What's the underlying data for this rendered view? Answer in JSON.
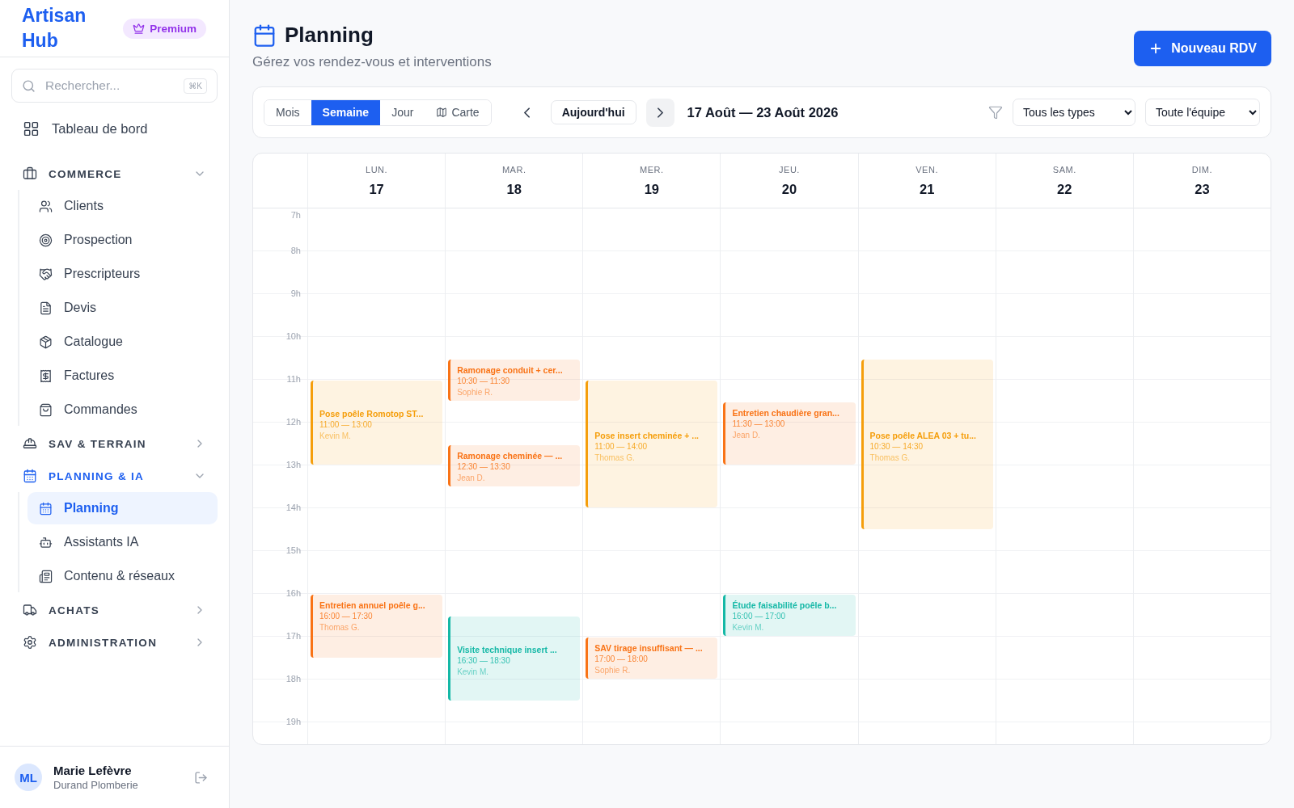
{
  "sidebar": {
    "logo": "Artisan Hub",
    "badge": "Premium",
    "search": {
      "placeholder": "Rechercher...",
      "shortcut": "⌘K"
    },
    "nav": [
      {
        "kind": "link",
        "label": "Tableau de bord",
        "selected": false
      },
      {
        "kind": "group",
        "label": "COMMERCE",
        "expanded": true,
        "active": false,
        "children": [
          {
            "label": "Clients",
            "selected": false
          },
          {
            "label": "Prospection",
            "selected": false
          },
          {
            "label": "Prescripteurs",
            "selected": false
          },
          {
            "label": "Devis",
            "selected": false
          },
          {
            "label": "Catalogue",
            "selected": false
          },
          {
            "label": "Factures",
            "selected": false
          },
          {
            "label": "Commandes",
            "selected": false
          }
        ]
      },
      {
        "kind": "group",
        "label": "SAV & TERRAIN",
        "expanded": false,
        "active": false
      },
      {
        "kind": "group",
        "label": "PLANNING & IA",
        "expanded": true,
        "active": true,
        "children": [
          {
            "label": "Planning",
            "selected": true
          },
          {
            "label": "Assistants IA",
            "selected": false
          },
          {
            "label": "Contenu & réseaux",
            "selected": false
          }
        ]
      },
      {
        "kind": "group",
        "label": "ACHATS",
        "expanded": false,
        "active": false
      },
      {
        "kind": "group",
        "label": "ADMINISTRATION",
        "expanded": false,
        "active": false
      }
    ],
    "user": {
      "initials": "ML",
      "name": "Marie Lefèvre",
      "company": "Durand Plomberie"
    }
  },
  "header": {
    "title": "Planning",
    "subtitle": "Gérez vos rendez-vous et interventions",
    "new_button": "Nouveau RDV"
  },
  "toolbar": {
    "views": [
      {
        "label": "Mois",
        "selected": false
      },
      {
        "label": "Semaine",
        "selected": true
      },
      {
        "label": "Jour",
        "selected": false
      },
      {
        "label": "Carte",
        "selected": false
      }
    ],
    "today": "Aujourd'hui",
    "range": "17 Août — 23 Août 2026",
    "filters": [
      "Tous les types",
      "Toute l'équipe"
    ]
  },
  "calendar": {
    "hours": [
      "7h",
      "8h",
      "9h",
      "10h",
      "11h",
      "12h",
      "13h",
      "14h",
      "15h",
      "16h",
      "17h",
      "18h",
      "19h"
    ],
    "days": [
      {
        "dow": "LUN.",
        "date": "17",
        "events": [
          {
            "title": "Pose poêle Romotop ST...",
            "time": "11:00 — 13:00",
            "person": "Kevin M.",
            "color": "#f59e0b"
          },
          {
            "title": "Entretien annuel poêle g...",
            "time": "16:00 — 17:30",
            "person": "Thomas G.",
            "color": "#f97316"
          }
        ]
      },
      {
        "dow": "MAR.",
        "date": "18",
        "events": [
          {
            "title": "Ramonage conduit + cer...",
            "time": "10:30 — 11:30",
            "person": "Sophie R.",
            "color": "#f97316"
          },
          {
            "title": "Ramonage cheminée — ...",
            "time": "12:30 — 13:30",
            "person": "Jean D.",
            "color": "#f97316"
          },
          {
            "title": "Visite technique insert ...",
            "time": "16:30 — 18:30",
            "person": "Kevin M.",
            "color": "#14b8a6"
          }
        ]
      },
      {
        "dow": "MER.",
        "date": "19",
        "events": [
          {
            "title": "Pose insert cheminée + ...",
            "time": "11:00 — 14:00",
            "person": "Thomas G.",
            "color": "#f59e0b"
          },
          {
            "title": "SAV tirage insuffisant — ...",
            "time": "17:00 — 18:00",
            "person": "Sophie R.",
            "color": "#f97316"
          }
        ]
      },
      {
        "dow": "JEU.",
        "date": "20",
        "events": [
          {
            "title": "Entretien chaudière gran...",
            "time": "11:30 — 13:00",
            "person": "Jean D.",
            "color": "#f97316"
          },
          {
            "title": "Étude faisabilité poêle b...",
            "time": "16:00 — 17:00",
            "person": "Kevin M.",
            "color": "#14b8a6"
          }
        ]
      },
      {
        "dow": "VEN.",
        "date": "21",
        "events": [
          {
            "title": "Pose poêle ALEA 03 + tu...",
            "time": "10:30 — 14:30",
            "person": "Thomas G.",
            "color": "#f59e0b"
          }
        ]
      },
      {
        "dow": "SAM.",
        "date": "22"
      },
      {
        "dow": "DIM.",
        "date": "23"
      }
    ]
  }
}
